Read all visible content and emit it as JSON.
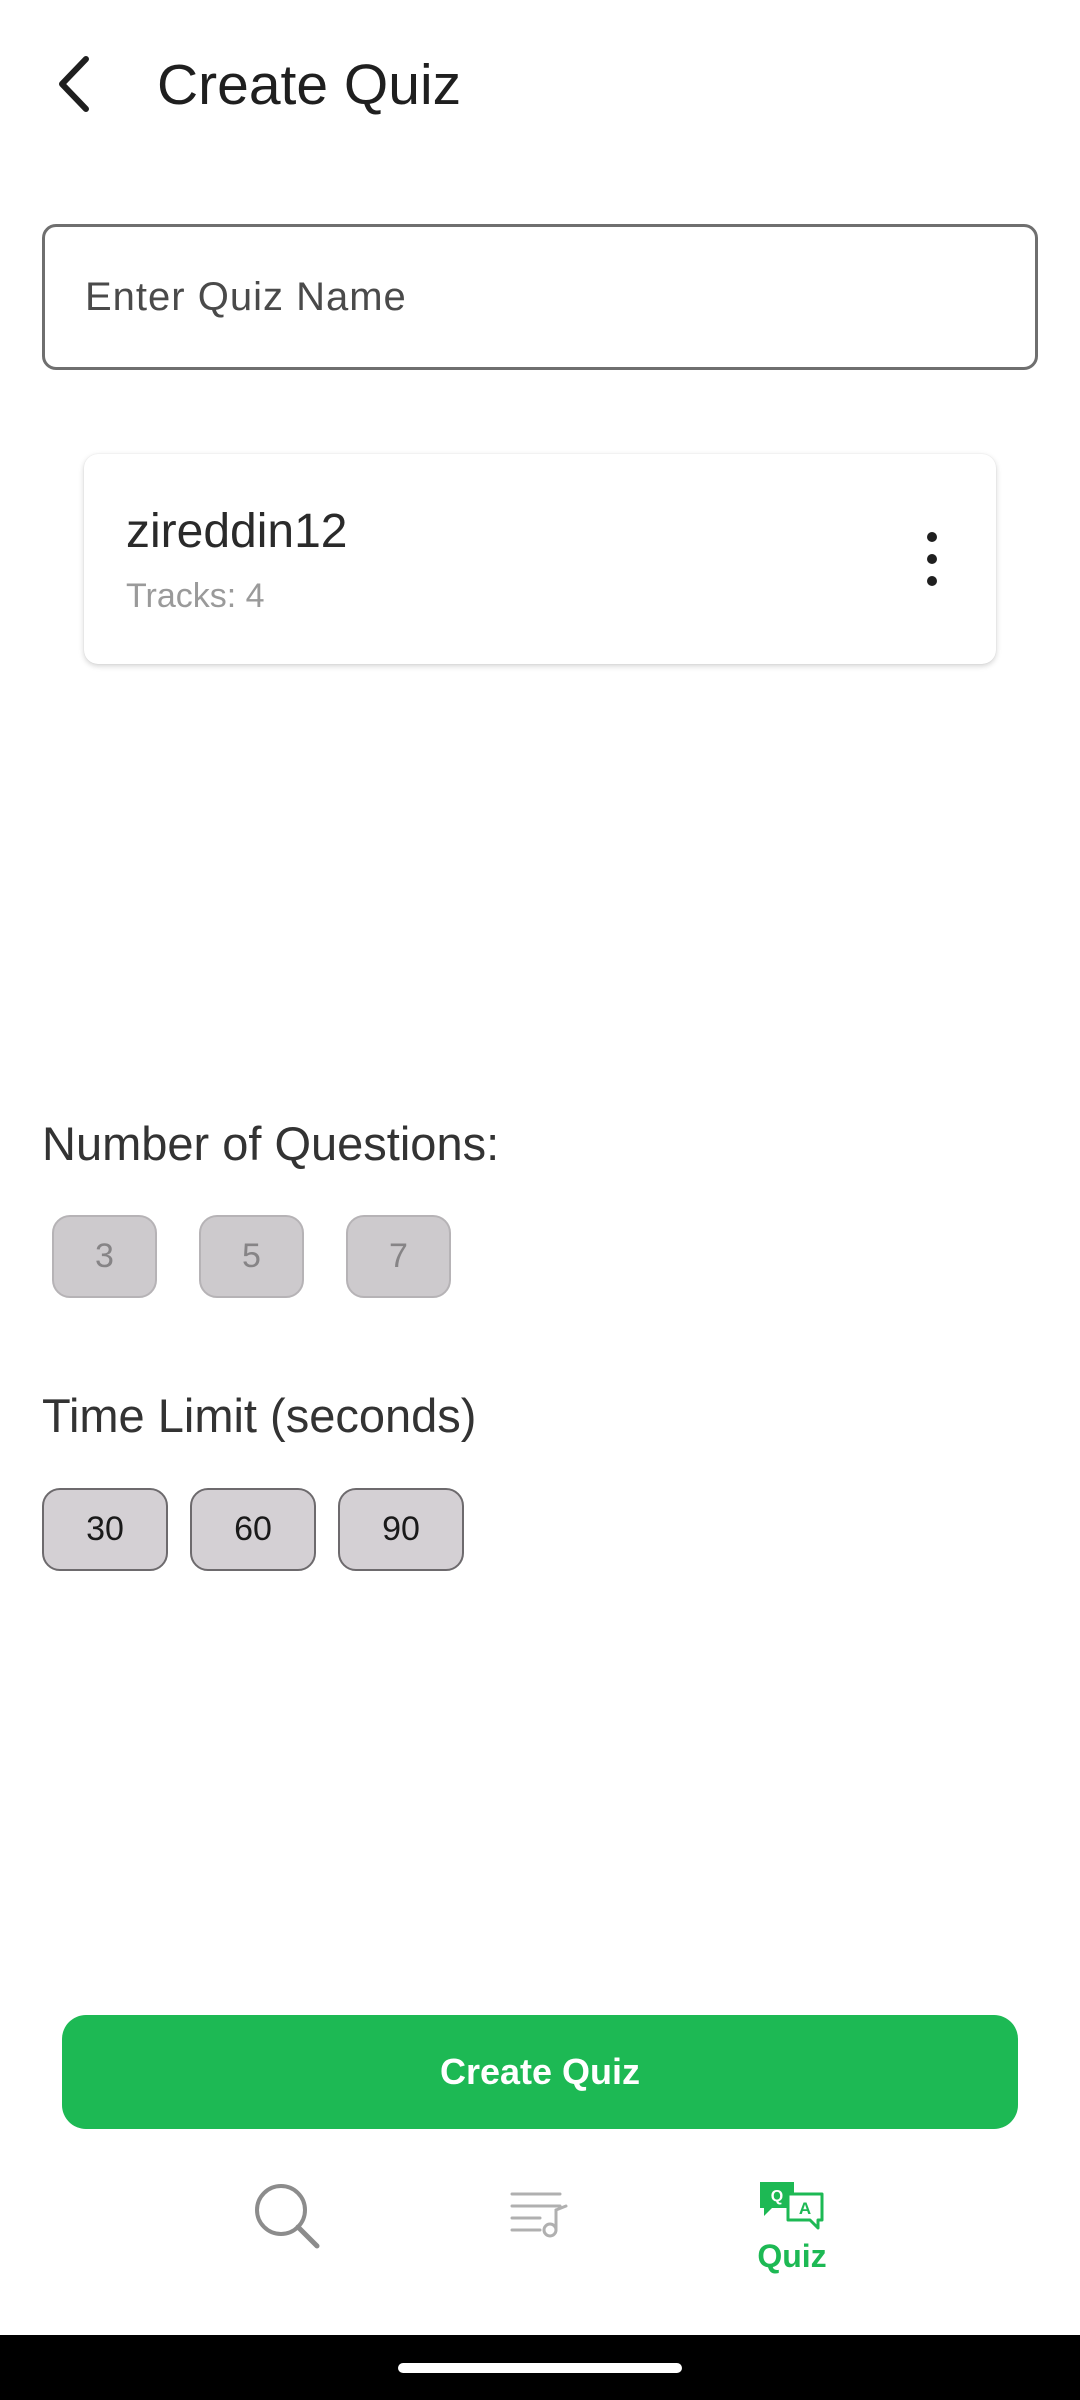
{
  "header": {
    "title": "Create Quiz",
    "back_icon": "chevron-left-icon"
  },
  "quiz_name": {
    "placeholder": "Enter Quiz Name",
    "value": ""
  },
  "playlist": {
    "name": "zireddin12",
    "tracks_label": "Tracks: 4",
    "menu_icon": "more-vertical-icon"
  },
  "questions": {
    "label": "Number of Questions:",
    "options": [
      "3",
      "5",
      "7"
    ]
  },
  "time_limit": {
    "label": "Time Limit (seconds)",
    "options": [
      "30",
      "60",
      "90"
    ]
  },
  "create_button": {
    "label": "Create Quiz"
  },
  "bottom_nav": {
    "items": [
      {
        "icon": "search-icon",
        "label": ""
      },
      {
        "icon": "library-music-icon",
        "label": ""
      },
      {
        "icon": "quiz-qa-icon",
        "label": "Quiz",
        "active": true
      }
    ]
  },
  "colors": {
    "accent": "#1db954",
    "chip_disabled": "#cdcacd",
    "chip_enabled": "#d4d0d4"
  }
}
